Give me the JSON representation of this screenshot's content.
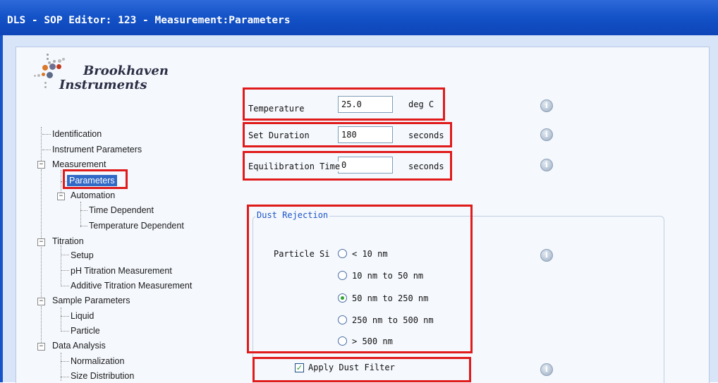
{
  "window": {
    "title": "DLS - SOP Editor: 123 - Measurement:Parameters"
  },
  "logo": {
    "line1": "Brookhaven",
    "line2": "Instruments"
  },
  "tree": {
    "identification": "Identification",
    "instrument_parameters": "Instrument Parameters",
    "measurement": "Measurement",
    "parameters": "Parameters",
    "automation": "Automation",
    "time_dependent": "Time Dependent",
    "temperature_dependent": "Temperature Dependent",
    "titration": "Titration",
    "setup": "Setup",
    "ph_titration": "pH Titration Measurement",
    "additive_titration": "Additive Titration Measurement",
    "sample_parameters": "Sample Parameters",
    "liquid": "Liquid",
    "particle": "Particle",
    "data_analysis": "Data Analysis",
    "normalization": "Normalization",
    "size_distribution": "Size Distribution",
    "expander_collapse": "−"
  },
  "form": {
    "temperature": {
      "label": "Temperature",
      "value": "25.0",
      "unit": "deg C"
    },
    "set_duration": {
      "label": "Set Duration",
      "value": "180",
      "unit": "seconds"
    },
    "equilibration_time": {
      "label": "Equilibration Time",
      "value": "0",
      "unit": "seconds"
    },
    "info_glyph": "i"
  },
  "dust_rejection": {
    "title": "Dust Rejection",
    "particle_label": "Particle Si",
    "options": [
      {
        "label": "< 10 nm",
        "selected": false
      },
      {
        "label": "10 nm to 50 nm",
        "selected": false
      },
      {
        "label": "50 nm to 250 nm",
        "selected": true
      },
      {
        "label": "250 nm to 500 nm",
        "selected": false
      },
      {
        "label": "> 500 nm",
        "selected": false
      }
    ],
    "apply_filter": {
      "label": "Apply Dust Filter",
      "checked": true,
      "check_glyph": "✓"
    }
  },
  "colors": {
    "titlebar": "#1453c8",
    "highlight_box": "#e01b1b",
    "selection": "#3169c6",
    "radio_selected": "#2aa52a"
  }
}
